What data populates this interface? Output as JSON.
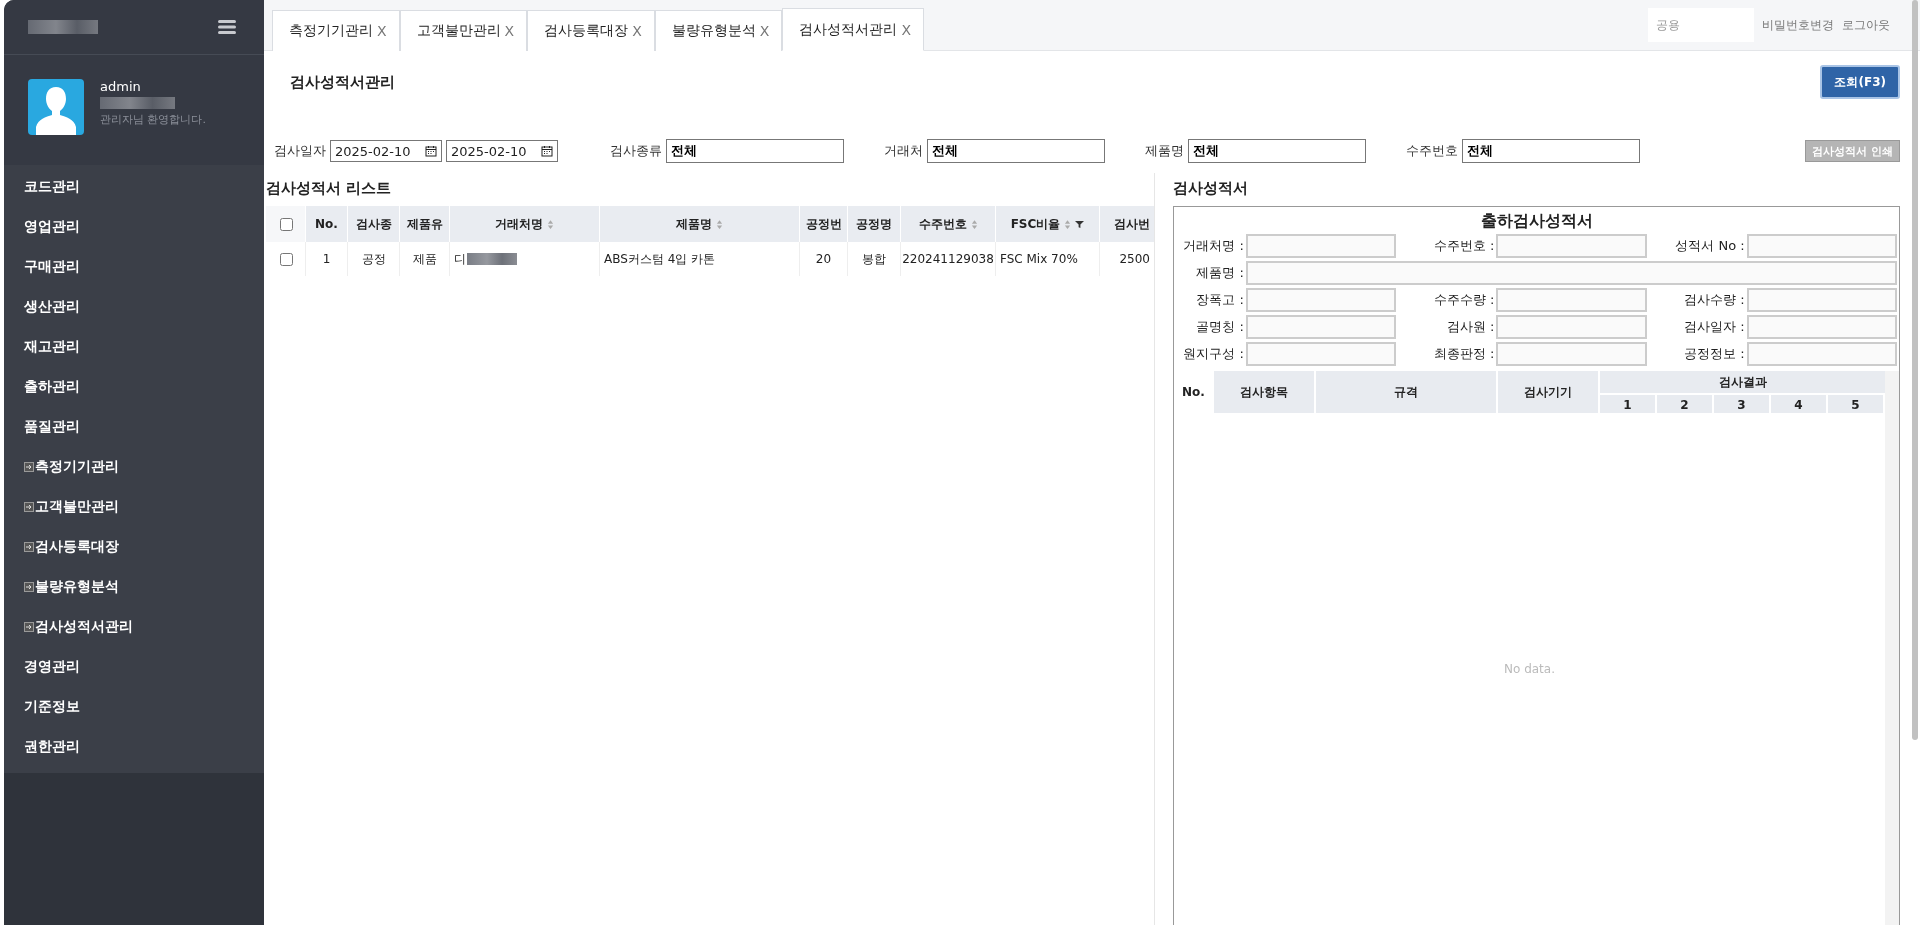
{
  "sidebar": {
    "user": {
      "name": "admin",
      "greeting": "관리자님 환영합니다."
    },
    "menu": [
      {
        "label": "코드관리",
        "kind": "group"
      },
      {
        "label": "영업관리",
        "kind": "group"
      },
      {
        "label": "구매관리",
        "kind": "group"
      },
      {
        "label": "생산관리",
        "kind": "group"
      },
      {
        "label": "재고관리",
        "kind": "group"
      },
      {
        "label": "출하관리",
        "kind": "group"
      },
      {
        "label": "품질관리",
        "kind": "group"
      },
      {
        "label": "측정기기관리",
        "kind": "page"
      },
      {
        "label": "고객불만관리",
        "kind": "page"
      },
      {
        "label": "검사등록대장",
        "kind": "page"
      },
      {
        "label": "불량유형분석",
        "kind": "page"
      },
      {
        "label": "검사성적서관리",
        "kind": "page"
      },
      {
        "label": "경영관리",
        "kind": "group"
      },
      {
        "label": "기준정보",
        "kind": "group"
      },
      {
        "label": "권한관리",
        "kind": "group"
      }
    ]
  },
  "tabs": [
    {
      "label": "측정기기관리",
      "close": "X",
      "selected": false
    },
    {
      "label": "고객불만관리",
      "close": "X",
      "selected": false
    },
    {
      "label": "검사등록대장",
      "close": "X",
      "selected": false
    },
    {
      "label": "불량유형분석",
      "close": "X",
      "selected": false
    },
    {
      "label": "검사성적서관리",
      "close": "X",
      "selected": true
    }
  ],
  "topbar": {
    "share_field": {
      "placeholder": "공용"
    },
    "links": [
      "비밀번호변경",
      "로그아웃"
    ]
  },
  "page_title": "검사성적서관리",
  "search_button": "조회(F3)",
  "filters": [
    {
      "label": "검사일자",
      "kind": "date_range",
      "values": [
        "2025-02-10",
        "2025-02-10"
      ]
    },
    {
      "label": "검사종류",
      "kind": "text",
      "value": "전체"
    },
    {
      "label": "거래처",
      "kind": "text",
      "value": "전체"
    },
    {
      "label": "제품명",
      "kind": "text",
      "value": "전체"
    },
    {
      "label": "수주번호",
      "kind": "text",
      "value": "전체"
    }
  ],
  "print_button": "검사성적서 인쇄",
  "list": {
    "title": "검사성적서 리스트",
    "all_checked": false,
    "columns": [
      {
        "label": "No.",
        "sortable": false,
        "filter": false
      },
      {
        "label": "검사종",
        "sortable": false,
        "filter": false
      },
      {
        "label": "제품유",
        "sortable": false,
        "filter": false
      },
      {
        "label": "거래처명",
        "sortable": true,
        "filter": false
      },
      {
        "label": "제품명",
        "sortable": true,
        "filter": false
      },
      {
        "label": "공정번",
        "sortable": false,
        "filter": false
      },
      {
        "label": "공정명",
        "sortable": false,
        "filter": false
      },
      {
        "label": "수주번호",
        "sortable": true,
        "filter": false
      },
      {
        "label": "FSC비율",
        "sortable": true,
        "filter": true
      },
      {
        "label": "검사번",
        "sortable": false,
        "filter": false
      }
    ],
    "rows": [
      {
        "checked": false,
        "cells": [
          "1",
          "공정",
          "제품",
          {
            "text": "디",
            "redacted": true
          },
          "ABS커스텀 4입 카톤",
          "20",
          "봉합",
          "220241129038",
          "FSC Mix 70%",
          "2500"
        ]
      }
    ]
  },
  "report": {
    "title": "검사성적서",
    "heading": "출하검사성적서",
    "fields": [
      {
        "label": "거래처명 :",
        "wide": false
      },
      {
        "label": "수주번호 :",
        "wide": false
      },
      {
        "label": "성적서 No :",
        "wide": false
      },
      {
        "label": "제품명 :",
        "wide": true
      },
      {
        "label": "장폭고 :",
        "wide": false
      },
      {
        "label": "수주수량 :",
        "wide": false
      },
      {
        "label": "검사수량 :",
        "wide": false
      },
      {
        "label": "골명칭 :",
        "wide": false
      },
      {
        "label": "검사원 :",
        "wide": false
      },
      {
        "label": "검사일자 :",
        "wide": false
      },
      {
        "label": "원지구성 :",
        "wide": false
      },
      {
        "label": "최종판정 :",
        "wide": false
      },
      {
        "label": "공정정보 :",
        "wide": false
      }
    ],
    "table": {
      "columns": [
        "No.",
        "검사항목",
        "규격",
        "검사기기"
      ],
      "group": "검사결과",
      "subcolumns": [
        "1",
        "2",
        "3",
        "4",
        "5"
      ],
      "empty": "No data."
    }
  }
}
